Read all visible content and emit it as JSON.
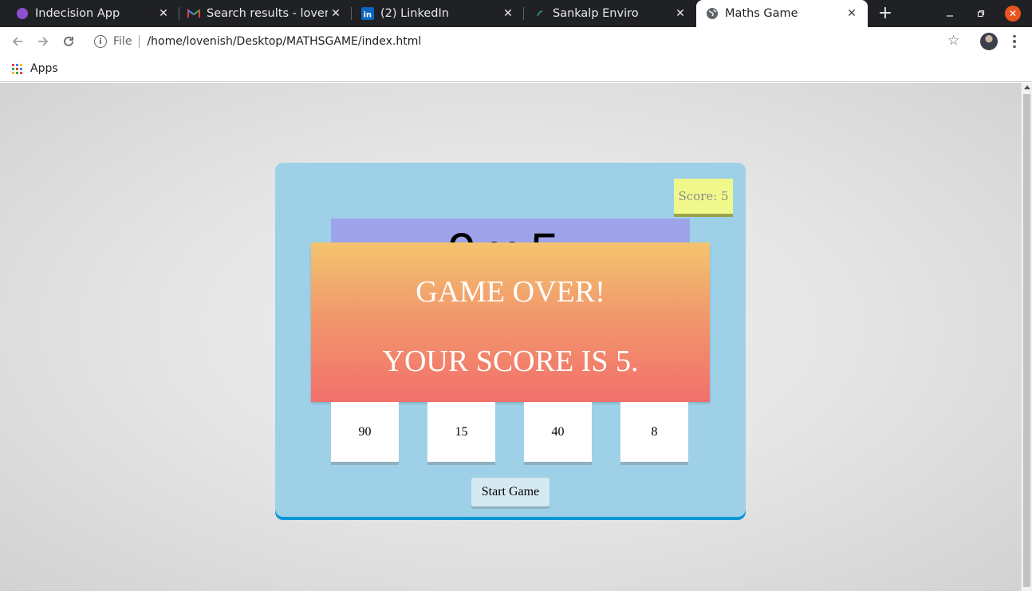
{
  "browser": {
    "tabs": [
      {
        "title": "Indecision App",
        "icon": "purple-circle-icon",
        "active": false
      },
      {
        "title": "Search results - lovenis",
        "icon": "gmail-icon",
        "active": false
      },
      {
        "title": "(2) LinkedIn",
        "icon": "linkedin-icon",
        "active": false
      },
      {
        "title": "Sankalp Enviro",
        "icon": "leaf-icon",
        "active": false
      },
      {
        "title": "Maths Game",
        "icon": "globe-icon",
        "active": true
      }
    ],
    "new_tab": "+",
    "address": {
      "scheme": "File",
      "url": "/home/lovenish/Desktop/MATHSGAME/index.html"
    },
    "bookmarks": {
      "apps_label": "Apps"
    }
  },
  "game": {
    "score_label": "Score: 5",
    "question_text": "9x5",
    "game_over": {
      "line1": "GAME OVER!",
      "line2": "YOUR SCORE IS 5."
    },
    "choices": [
      "90",
      "15",
      "40",
      "8"
    ],
    "start_button": "Start Game"
  },
  "colors": {
    "game_bg": "#9ed1e8",
    "score_bg": "#f0f88c",
    "question_bg": "#9ea3ea",
    "gameover_top": "#f3c46e",
    "gameover_bottom": "#f2706c"
  }
}
